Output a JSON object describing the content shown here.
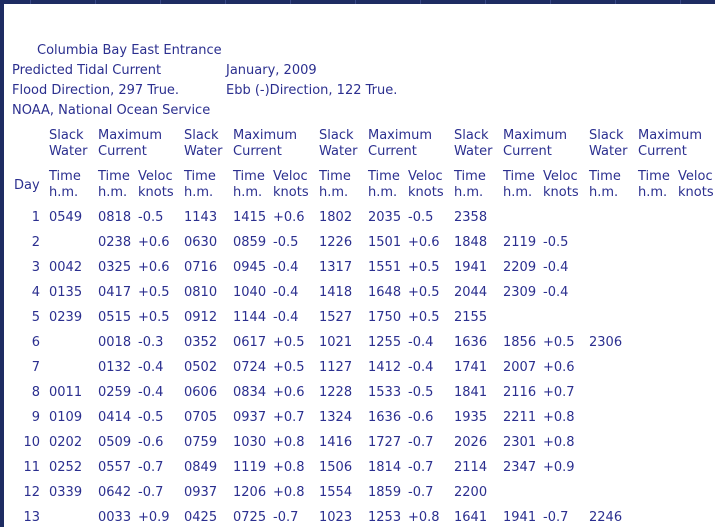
{
  "header": {
    "station": "Columbia Bay East Entrance",
    "title": "Predicted Tidal Current",
    "month": "January, 2009",
    "flood": "Flood Direction, 297 True.",
    "ebb": "Ebb (-)Direction, 122 True.",
    "source": "NOAA, National Ocean Service"
  },
  "columns": {
    "group_top": [
      "Slack",
      "Maximum",
      "Slack",
      "Maximum",
      "Slack",
      "Maximum",
      "Slack",
      "Maximum",
      "Slack",
      "Maximum"
    ],
    "group_bottom": [
      "Water",
      "Current",
      "Water",
      "Current",
      "Water",
      "Current",
      "Water",
      "Current",
      "Water",
      "Current"
    ],
    "day": "Day",
    "sub_top": [
      "Time",
      "Time",
      "Veloc",
      "Time",
      "Time",
      "Veloc",
      "Time",
      "Time",
      "Veloc",
      "Time",
      "Time",
      "Veloc",
      "Time",
      "Time",
      "Veloc"
    ],
    "sub_bottom": [
      "h.m.",
      "h.m.",
      "knots",
      "h.m.",
      "h.m.",
      "knots",
      "h.m.",
      "h.m.",
      "knots",
      "h.m.",
      "h.m.",
      "knots",
      "h.m.",
      "h.m.",
      "knots"
    ]
  },
  "rows": [
    {
      "day": "1",
      "cells": [
        "0549",
        "0818",
        "-0.5",
        "1143",
        "1415",
        "+0.6",
        "1802",
        "2035",
        "-0.5",
        "2358",
        "",
        "",
        "",
        "",
        ""
      ]
    },
    {
      "day": "2",
      "cells": [
        "",
        "0238",
        "+0.6",
        "0630",
        "0859",
        "-0.5",
        "1226",
        "1501",
        "+0.6",
        "1848",
        "2119",
        "-0.5",
        "",
        "",
        ""
      ]
    },
    {
      "day": "3",
      "cells": [
        "0042",
        "0325",
        "+0.6",
        "0716",
        "0945",
        "-0.4",
        "1317",
        "1551",
        "+0.5",
        "1941",
        "2209",
        "-0.4",
        "",
        "",
        ""
      ]
    },
    {
      "day": "4",
      "cells": [
        "0135",
        "0417",
        "+0.5",
        "0810",
        "1040",
        "-0.4",
        "1418",
        "1648",
        "+0.5",
        "2044",
        "2309",
        "-0.4",
        "",
        "",
        ""
      ]
    },
    {
      "day": "5",
      "cells": [
        "0239",
        "0515",
        "+0.5",
        "0912",
        "1144",
        "-0.4",
        "1527",
        "1750",
        "+0.5",
        "2155",
        "",
        "",
        "",
        "",
        ""
      ]
    },
    {
      "day": "6",
      "cells": [
        "",
        "0018",
        "-0.3",
        "0352",
        "0617",
        "+0.5",
        "1021",
        "1255",
        "-0.4",
        "1636",
        "1856",
        "+0.5",
        "2306",
        "",
        ""
      ]
    },
    {
      "day": "7",
      "cells": [
        "",
        "0132",
        "-0.4",
        "0502",
        "0724",
        "+0.5",
        "1127",
        "1412",
        "-0.4",
        "1741",
        "2007",
        "+0.6",
        "",
        "",
        ""
      ]
    },
    {
      "day": "8",
      "cells": [
        "0011",
        "0259",
        "-0.4",
        "0606",
        "0834",
        "+0.6",
        "1228",
        "1533",
        "-0.5",
        "1841",
        "2116",
        "+0.7",
        "",
        "",
        ""
      ]
    },
    {
      "day": "9",
      "cells": [
        "0109",
        "0414",
        "-0.5",
        "0705",
        "0937",
        "+0.7",
        "1324",
        "1636",
        "-0.6",
        "1935",
        "2211",
        "+0.8",
        "",
        "",
        ""
      ]
    },
    {
      "day": "10",
      "cells": [
        "0202",
        "0509",
        "-0.6",
        "0759",
        "1030",
        "+0.8",
        "1416",
        "1727",
        "-0.7",
        "2026",
        "2301",
        "+0.8",
        "",
        "",
        ""
      ]
    },
    {
      "day": "11",
      "cells": [
        "0252",
        "0557",
        "-0.7",
        "0849",
        "1119",
        "+0.8",
        "1506",
        "1814",
        "-0.7",
        "2114",
        "2347",
        "+0.9",
        "",
        "",
        ""
      ]
    },
    {
      "day": "12",
      "cells": [
        "0339",
        "0642",
        "-0.7",
        "0937",
        "1206",
        "+0.8",
        "1554",
        "1859",
        "-0.7",
        "2200",
        "",
        "",
        "",
        "",
        ""
      ]
    },
    {
      "day": "13",
      "cells": [
        "",
        "0033",
        "+0.9",
        "0425",
        "0725",
        "-0.7",
        "1023",
        "1253",
        "+0.8",
        "1641",
        "1941",
        "-0.7",
        "2246",
        "",
        ""
      ]
    }
  ]
}
